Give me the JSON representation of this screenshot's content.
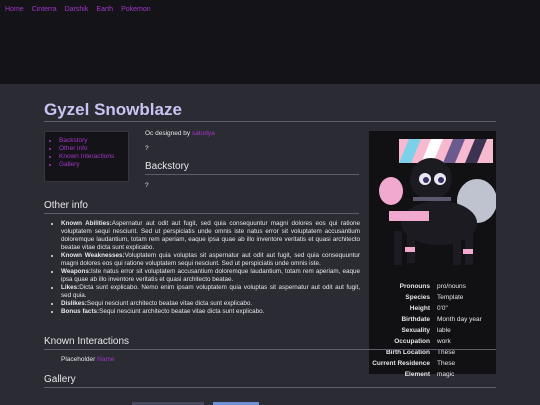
{
  "nav": {
    "links": [
      "Home",
      "Cinterra",
      "Darshik",
      "Earth",
      "Pokemon"
    ]
  },
  "page": {
    "title": "Gyzel Snowblaze"
  },
  "toc": {
    "items": [
      "Backstory",
      "Other info",
      "Known Interactions",
      "Gallery"
    ]
  },
  "credit": {
    "prefix": "Oc designed by",
    "designer": "satudya"
  },
  "intro": {
    "text": "?"
  },
  "backstory": {
    "heading": "Backstory",
    "text": "?"
  },
  "otherinfo": {
    "heading": "Other info",
    "items": [
      {
        "label": "Known Abilities:",
        "text": "Aspernatur aut odit aut fugit, sed quia consequuntur magni dolores eos qui ratione voluptatem sequi nesciunt. Sed ut perspiciatis unde omnis iste natus error sit voluptatem accusantium doloremque laudantium, totam rem aperiam, eaque ipsa quae ab illo inventore veritatis et quasi architecto beatae vitae dicta sunt explicabo."
      },
      {
        "label": "Known Weaknesses:",
        "text": "Voluptatem quia voluptas sit aspernatur aut odit aut fugit, sed quia consequuntur magni dolores eos qui ratione voluptatem sequi nesciunt. Sed ut perspiciatis unde omnis iste."
      },
      {
        "label": "Weapons:",
        "text": "Iste natus error sit voluptatem accusantium doloremque laudantium, totam rem aperiam, eaque ipsa quae ab illo inventore veritatis et quasi architecto beatae."
      },
      {
        "label": "Likes:",
        "text": "Dicta sunt explicabo. Nemo enim ipsam voluptatem quia voluptas sit aspernatur aut odit aut fugit, sed quia."
      },
      {
        "label": "Dislikes:",
        "text": "Sequi nesciunt architecto beatae vitae dicta sunt explicabo."
      },
      {
        "label": "Bonus facts:",
        "text": "Sequi nesciunt architecto beatae vitae dicta sunt explicabo."
      }
    ]
  },
  "known": {
    "heading": "Known Interactions",
    "placeholder": "Placeholder",
    "name": "Name"
  },
  "gallery": {
    "heading": "Gallery"
  },
  "infobox": {
    "rows": [
      {
        "key": "Pronouns",
        "value": "pro/nouns"
      },
      {
        "key": "Species",
        "value": "Template"
      },
      {
        "key": "Height",
        "value": "0'0\""
      },
      {
        "key": "Birthdate",
        "value": "Month day year"
      },
      {
        "key": "Sexuality",
        "value": "lable"
      },
      {
        "key": "Occupation",
        "value": "work"
      },
      {
        "key": "Birth Location",
        "value": "These"
      },
      {
        "key": "Current Residence",
        "value": "These"
      },
      {
        "key": "Element",
        "value": "magic"
      }
    ]
  },
  "colors": {
    "accent": "#a236c9",
    "title": "#c8c3f2",
    "background": "#2b2b33",
    "panel": "#141418"
  }
}
